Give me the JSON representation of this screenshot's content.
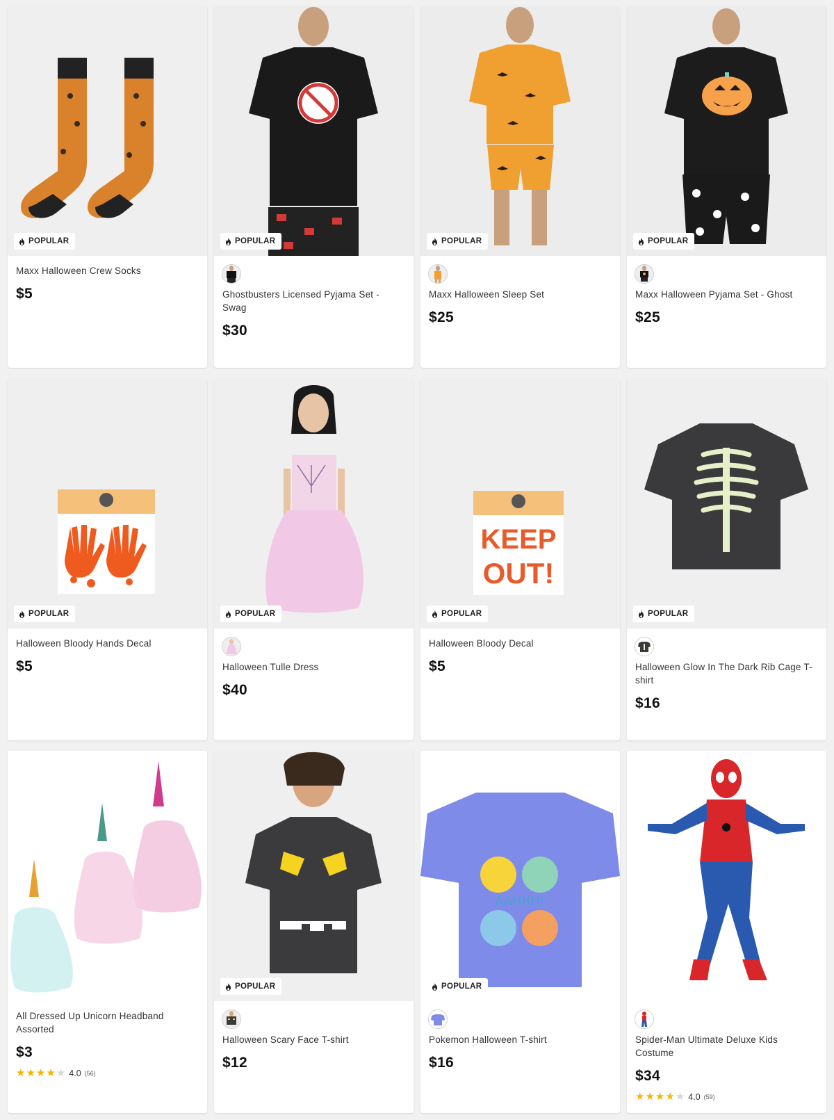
{
  "badge_label": "POPULAR",
  "colors": {
    "accent_star": "#f5b400",
    "background": "#f1f1f1",
    "card": "#ffffff"
  },
  "products": [
    {
      "title": "Maxx Halloween Crew Socks",
      "price": "$5",
      "popular": true,
      "thumb": false,
      "image": "halloween-bat-socks",
      "rating": null
    },
    {
      "title": "Ghostbusters Licensed Pyjama Set - Swag",
      "price": "$30",
      "popular": true,
      "thumb": true,
      "image": "ghostbusters-tshirt",
      "rating": null
    },
    {
      "title": "Maxx Halloween Sleep Set",
      "price": "$25",
      "popular": true,
      "thumb": true,
      "image": "orange-bat-sleep-set",
      "rating": null
    },
    {
      "title": "Maxx Halloween Pyjama Set - Ghost",
      "price": "$25",
      "popular": true,
      "thumb": true,
      "image": "pumpkin-tshirt-pyjama",
      "rating": null
    },
    {
      "title": "Halloween Bloody Hands Decal",
      "price": "$5",
      "popular": true,
      "thumb": false,
      "image": "bloody-hands-decal",
      "rating": null
    },
    {
      "title": "Halloween Tulle Dress",
      "price": "$40",
      "popular": true,
      "thumb": true,
      "image": "pink-tulle-dress",
      "rating": null
    },
    {
      "title": "Halloween Bloody Decal",
      "price": "$5",
      "popular": true,
      "thumb": false,
      "image": "keep-out-decal",
      "rating": null
    },
    {
      "title": "Halloween Glow In The Dark Rib Cage T-shirt",
      "price": "$16",
      "popular": true,
      "thumb": true,
      "image": "rib-cage-tshirt",
      "rating": null
    },
    {
      "title": "All Dressed Up Unicorn Headband Assorted",
      "price": "$3",
      "popular": false,
      "thumb": false,
      "image": "unicorn-headbands",
      "rating": {
        "stars": 4,
        "value": "4.0",
        "count": "(56)"
      }
    },
    {
      "title": "Halloween Scary Face T-shirt",
      "price": "$12",
      "popular": true,
      "thumb": true,
      "image": "scary-face-tshirt",
      "rating": null
    },
    {
      "title": "Pokemon Halloween T-shirt",
      "price": "$16",
      "popular": true,
      "thumb": true,
      "image": "pokemon-tshirt",
      "rating": null
    },
    {
      "title": "Spider-Man Ultimate Deluxe Kids Costume",
      "price": "$34",
      "popular": false,
      "thumb": true,
      "image": "spiderman-costume",
      "rating": {
        "stars": 4,
        "value": "4.0",
        "count": "(59)"
      }
    }
  ]
}
